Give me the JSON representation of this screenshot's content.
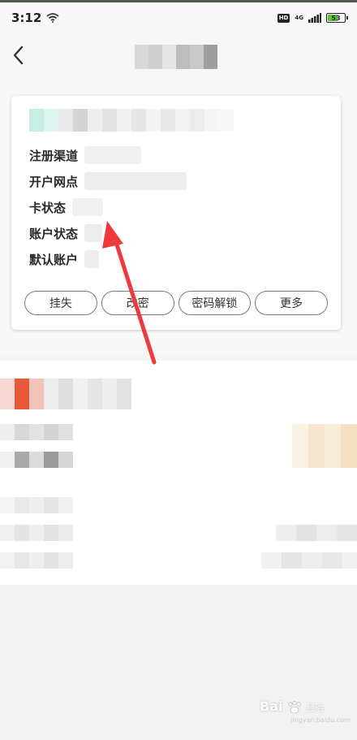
{
  "status_bar": {
    "time": "3:12",
    "hd": "HD",
    "network": "4G",
    "battery": "53"
  },
  "nav": {
    "back_icon": "chevron-left-icon"
  },
  "card": {
    "rows": [
      {
        "label": "注册渠道"
      },
      {
        "label": "开户网点"
      },
      {
        "label": "卡状态"
      },
      {
        "label": "账户状态"
      },
      {
        "label": "默认账户"
      }
    ],
    "actions": [
      {
        "label": "挂失"
      },
      {
        "label": "改密"
      },
      {
        "label": "密码解锁"
      },
      {
        "label": "更多"
      }
    ]
  },
  "annotation": {
    "color": "#f0393a"
  },
  "watermark": {
    "text": "Bai",
    "suffix": "经验",
    "sub": "jingyan.baidu.com"
  }
}
